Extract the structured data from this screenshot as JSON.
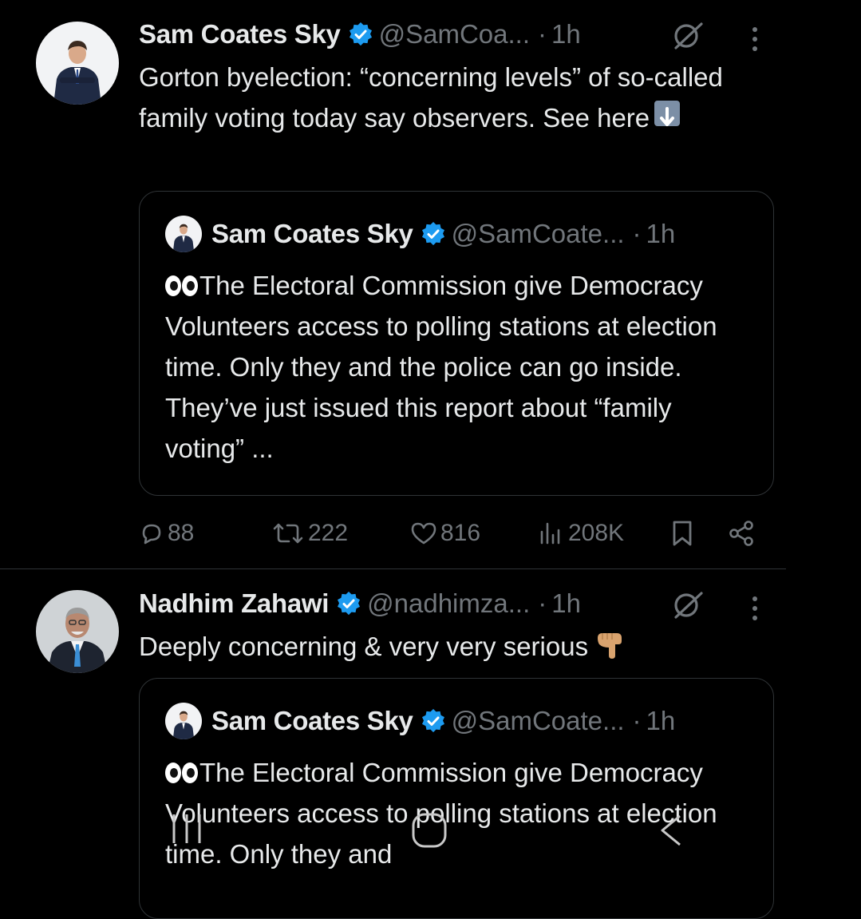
{
  "tweets": [
    {
      "author_name": "Sam Coates Sky",
      "handle": "@SamCoa...",
      "dot": "·",
      "time": "1h",
      "text": "Gorton byelection: “concerning levels” of so-called family voting today say observers. See here",
      "text_emoji": "down-arrow-emoji",
      "quote": {
        "author_name": "Sam Coates Sky",
        "handle": "@SamCoate...",
        "dot": "·",
        "time": "1h",
        "text": "The Electoral Commission give Democracy Volunteers access to polling stations at election time. Only they and the police  can go inside. They’ve just issued this report about “family voting” ..."
      },
      "actions": {
        "replies": "88",
        "reposts": "222",
        "likes": "816",
        "views": "208K"
      }
    },
    {
      "author_name": "Nadhim Zahawi",
      "handle": "@nadhimza...",
      "dot": "·",
      "time": "1h",
      "text": "Deeply concerning & very very serious",
      "text_emoji": "pointing-down-emoji",
      "quote": {
        "author_name": "Sam Coates Sky",
        "handle": "@SamCoate...",
        "dot": "·",
        "time": "1h",
        "text": "The Electoral Commission give Democracy Volunteers access to polling stations at election time. Only they and"
      }
    }
  ],
  "colors": {
    "background": "#000000",
    "text": "#e7e9ea",
    "muted": "#71767b",
    "verified": "#1d9bf0",
    "border": "#2f3336"
  },
  "navigation": [
    "recent-apps-icon",
    "home-icon",
    "back-icon"
  ]
}
